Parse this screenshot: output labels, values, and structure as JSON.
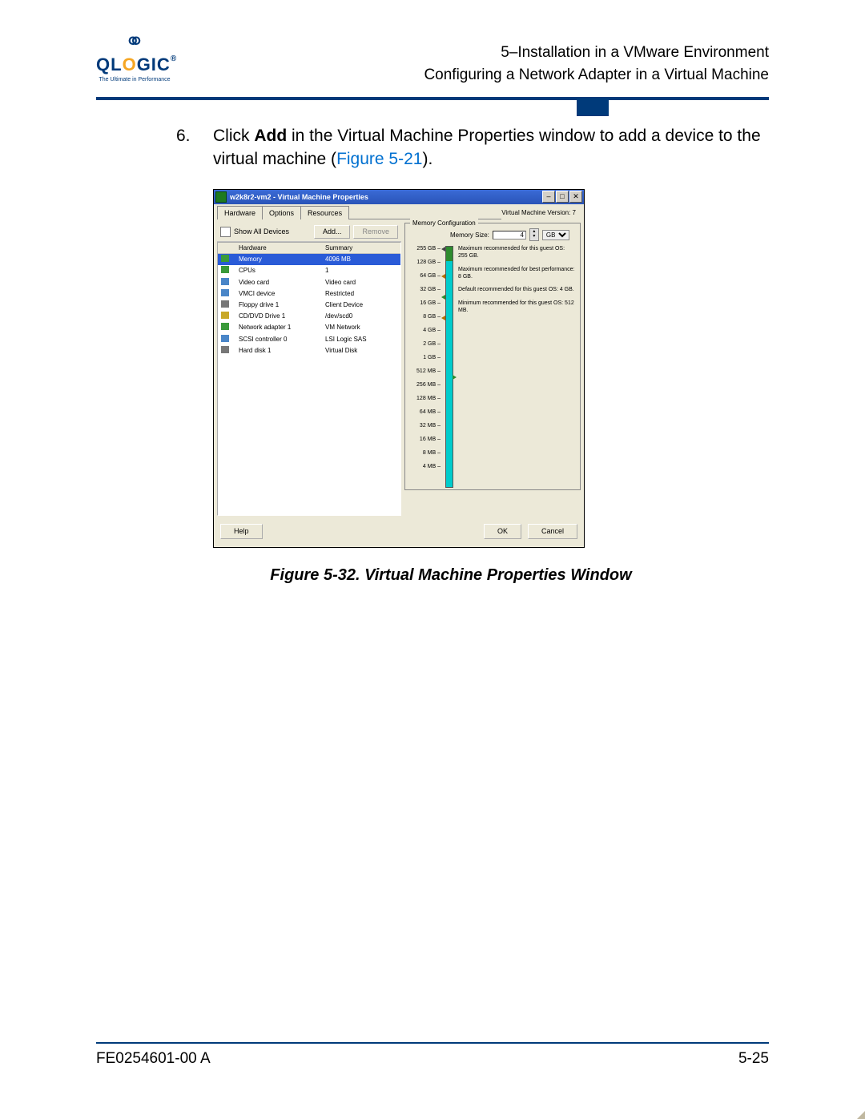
{
  "header": {
    "brand_prefix": "QL",
    "brand_mid": "O",
    "brand_suffix": "GIC",
    "tagline": "The Ultimate in Performance",
    "line1": "5–Installation in a VMware Environment",
    "line2": "Configuring a Network Adapter in a Virtual Machine"
  },
  "step": {
    "num": "6.",
    "pre": "Click ",
    "bold": "Add",
    "mid": " in the Virtual Machine Properties window to add a device to the virtual machine (",
    "link": "Figure 5-21",
    "post": ")."
  },
  "win": {
    "title": "w2k8r2-vm2 - Virtual Machine Properties",
    "ctl_min": "–",
    "ctl_max": "□",
    "ctl_close": "✕",
    "tabs": [
      "Hardware",
      "Options",
      "Resources"
    ],
    "version": "Virtual Machine Version: 7",
    "show_all": "Show All Devices",
    "add_btn": "Add...",
    "remove_btn": "Remove",
    "cols": [
      "Hardware",
      "Summary"
    ],
    "rows": [
      {
        "name": "Memory",
        "summary": "4096 MB",
        "sel": true,
        "color": "#3a9a3a"
      },
      {
        "name": "CPUs",
        "summary": "1",
        "color": "#3a9a3a"
      },
      {
        "name": "Video card",
        "summary": "Video card",
        "color": "#4a86c8"
      },
      {
        "name": "VMCI device",
        "summary": "Restricted",
        "color": "#4a86c8"
      },
      {
        "name": "Floppy drive 1",
        "summary": "Client Device",
        "color": "#777"
      },
      {
        "name": "CD/DVD Drive 1",
        "summary": "/dev/scd0",
        "color": "#c8a828"
      },
      {
        "name": "Network adapter 1",
        "summary": "VM Network",
        "color": "#3a9a3a"
      },
      {
        "name": "SCSI controller 0",
        "summary": "LSI Logic SAS",
        "color": "#4a86c8"
      },
      {
        "name": "Hard disk 1",
        "summary": "Virtual Disk",
        "color": "#777"
      }
    ],
    "mem": {
      "group": "Memory Configuration",
      "size_label": "Memory Size:",
      "size_val": "4",
      "unit": "GB",
      "units": [
        "GB"
      ],
      "ticks": [
        "255 GB",
        "128 GB",
        "64 GB",
        "32 GB",
        "16 GB",
        "8 GB",
        "4 GB",
        "2 GB",
        "1 GB",
        "512 MB",
        "256 MB",
        "128 MB",
        "64 MB",
        "32 MB",
        "16 MB",
        "8 MB",
        "4 MB"
      ],
      "notes": [
        "Maximum recommended for this guest OS: 255 GB.",
        "Maximum recommended for best performance: 8 GB.",
        "Default recommended for this guest OS: 4 GB.",
        "Minimum recommended for this guest OS: 512 MB."
      ]
    },
    "help": "Help",
    "ok": "OK",
    "cancel": "Cancel"
  },
  "caption": "Figure 5-32. Virtual Machine Properties Window",
  "footer": {
    "doc": "FE0254601-00 A",
    "page": "5-25"
  }
}
